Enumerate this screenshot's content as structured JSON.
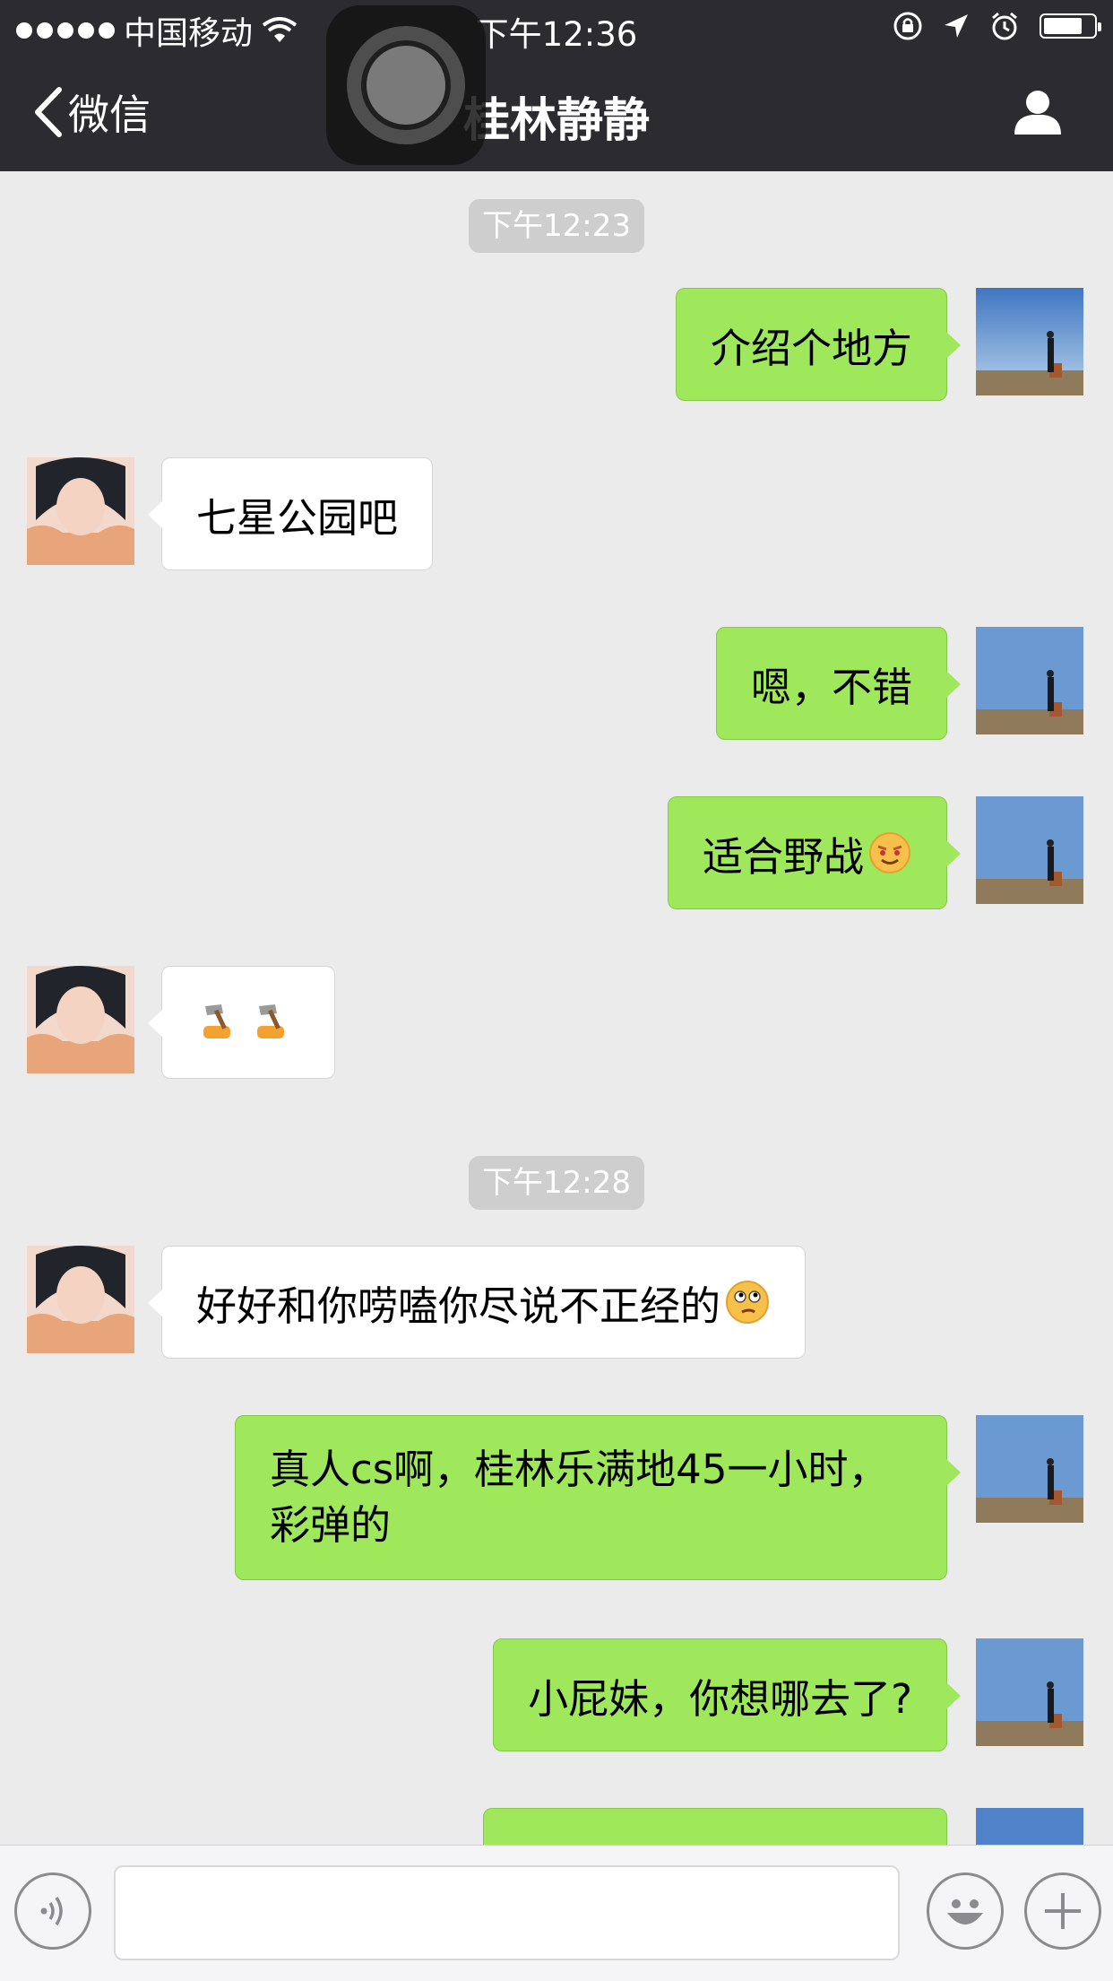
{
  "status_bar": {
    "carrier": "中国移动",
    "time": "下午12:36"
  },
  "nav": {
    "back_label": "微信",
    "title": "桂林静静"
  },
  "chat": {
    "timestamps": [
      "下午12:23",
      "下午12:28"
    ],
    "messages": [
      {
        "from": "me",
        "text": "介绍个地方"
      },
      {
        "from": "her",
        "text": "七星公园吧"
      },
      {
        "from": "me",
        "text": "嗯，不错"
      },
      {
        "from": "me",
        "text": "适合野战"
      },
      {
        "from": "her",
        "text": ""
      },
      {
        "from": "her",
        "text": "好好和你唠嗑你尽说不正经的"
      },
      {
        "from": "me",
        "text": "真人cs啊，桂林乐满地45一小时，彩弹的"
      },
      {
        "from": "me",
        "text": "小屁妹，你想哪去了?"
      }
    ]
  },
  "colors": {
    "nav_bg": "#2c2b30",
    "chat_bg": "#ebebeb",
    "outgoing_bubble": "#9fe85b",
    "incoming_bubble": "#ffffff"
  },
  "icons": [
    "wifi-icon",
    "lock-rotation-icon",
    "location-icon",
    "alarm-icon",
    "battery-icon",
    "back-chevron-icon",
    "profile-icon",
    "voice-icon",
    "emoji-icon",
    "plus-icon"
  ]
}
